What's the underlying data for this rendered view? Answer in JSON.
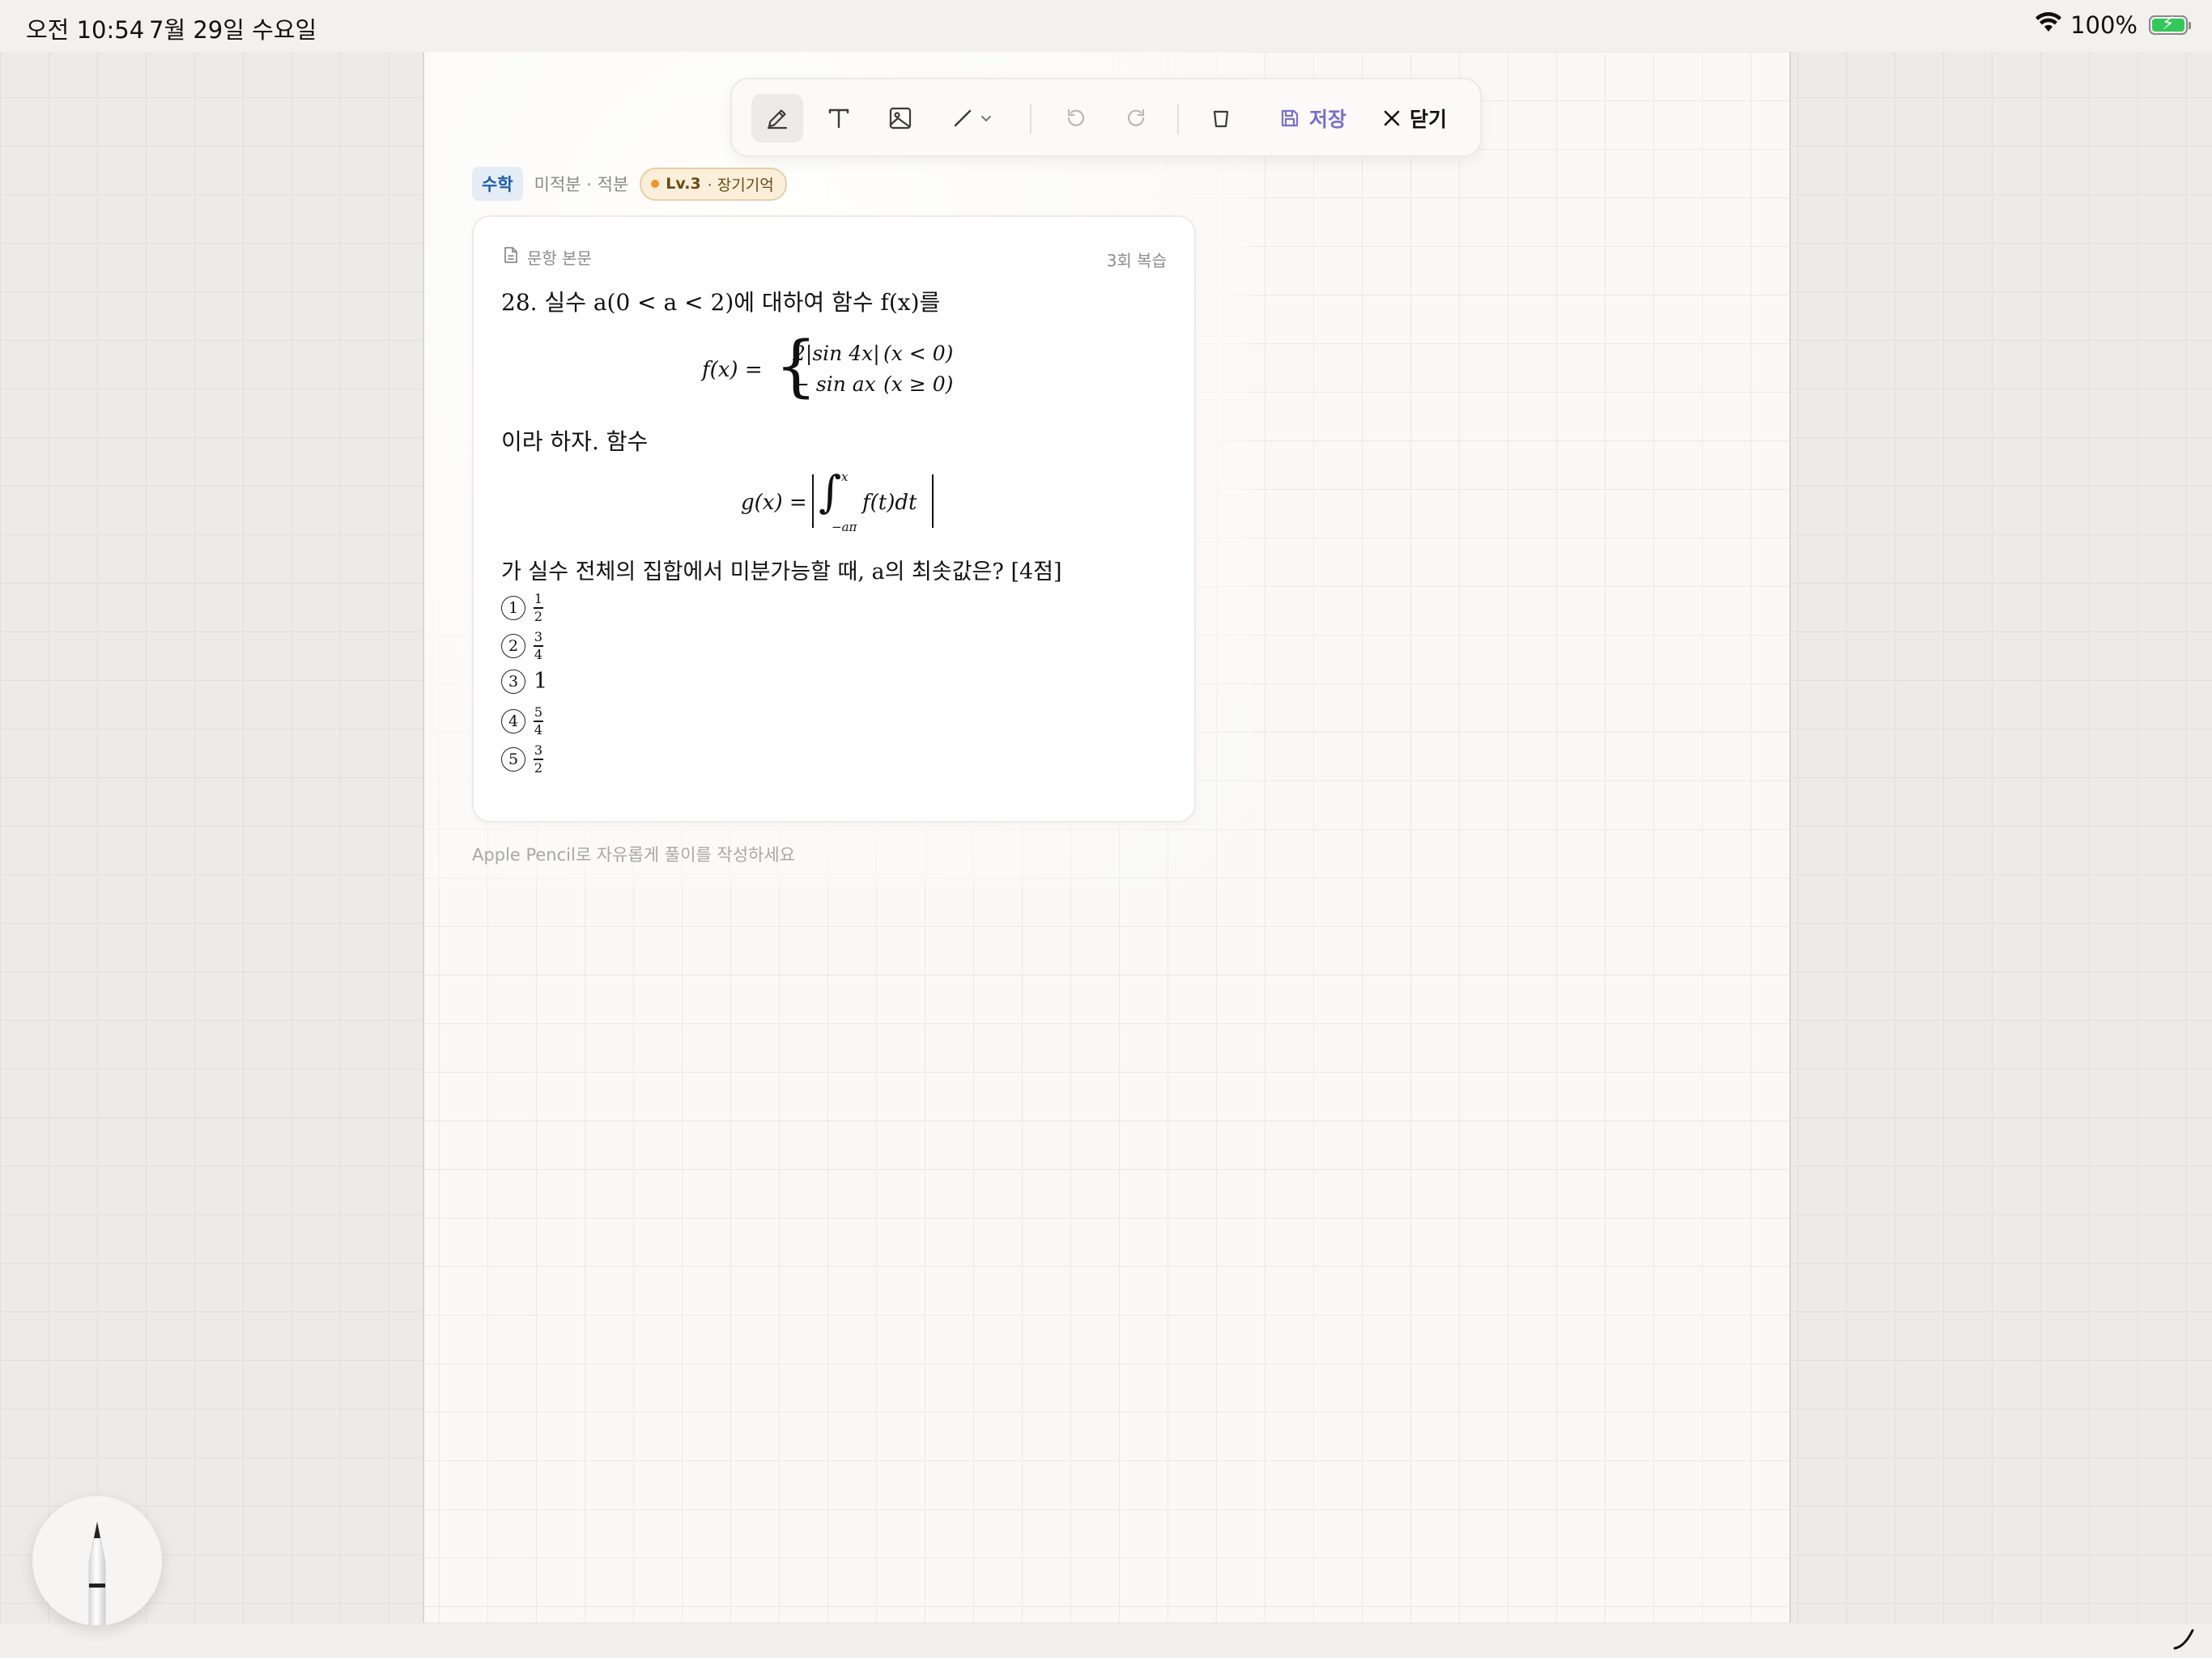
{
  "status_bar": {
    "time": "오전 10:54",
    "date": "7월 29일 수요일",
    "battery": "100%",
    "icons": [
      "wifi-icon",
      "battery-charging-icon"
    ]
  },
  "toolbar": {
    "tools": [
      "pen-icon",
      "text-icon",
      "image-icon",
      "line-icon",
      "undo-icon",
      "redo-icon",
      "eraser-icon"
    ],
    "save_label": "저장",
    "close_label": "닫기"
  },
  "tags": {
    "subject": "수학",
    "topic": "미적분 · 적분",
    "level": "Lv.3",
    "level_label": "· 장기기억"
  },
  "card": {
    "header_label": "문항 본문",
    "review_count": "3회 복습",
    "question_intro": "28.  실수 a(0 < a < 2)에 대하여 함수 f(x)를",
    "fx_lhs": "f(x) =",
    "fx_case1_expr": "2|sin 4x|",
    "fx_case1_cond": "(x < 0)",
    "fx_case2_expr": "− sin ax",
    "fx_case2_cond": "(x ≥ 0)",
    "line_mid": "이라 하자. 함수",
    "gx_lhs": "g(x) =",
    "gx_upper": "x",
    "gx_lower": "−aπ",
    "gx_integrand": "f(t)dt",
    "question_end": "가 실수 전체의 집합에서 미분가능할 때, a의 최솟값은? [4점]",
    "choices": [
      {
        "num": "1",
        "numerator": "1",
        "denominator": "2"
      },
      {
        "num": "2",
        "numerator": "3",
        "denominator": "4"
      },
      {
        "num": "3",
        "value": "1"
      },
      {
        "num": "4",
        "numerator": "5",
        "denominator": "4"
      },
      {
        "num": "5",
        "numerator": "3",
        "denominator": "2"
      }
    ]
  },
  "hint": "Apple Pencil로 자유롭게 풀이를 작성하세요",
  "colors": {
    "accent_blue": "#1f5fa8",
    "level_dot": "#f0962a",
    "battery_green": "#34c759",
    "save_purple": "#7a6fd0"
  }
}
